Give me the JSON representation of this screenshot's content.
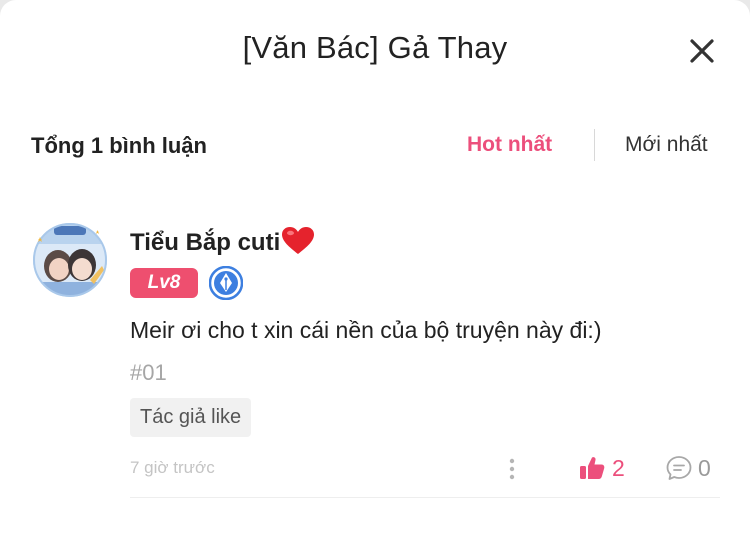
{
  "header": {
    "title": "[Văn Bác] Gả Thay",
    "close_icon": "close-icon"
  },
  "toolbar": {
    "count_label": "Tổng 1 bình luận",
    "sort_hot_label": "Hot nhất",
    "sort_new_label": "Mới nhất",
    "active_sort": "Hot nhất"
  },
  "comments": [
    {
      "username": "Tiểu Bắp cuti",
      "name_emoji": "heart-icon",
      "level": "Lv8",
      "badge_icon": "pen-nib-badge-icon",
      "text": "Meir ơi cho t xin cái nền của bộ truyện này đi:)",
      "chapter": "#01",
      "tag": "Tác giả like",
      "time": "7 giờ trước",
      "like_count": "2",
      "reply_count": "0",
      "liked": true
    }
  ],
  "colors": {
    "accent": "#ec4f7c",
    "level_badge": "#ee4f6f",
    "badge_blue": "#3d7fe0",
    "text_primary": "#222222",
    "text_muted": "#a6a6a6"
  }
}
